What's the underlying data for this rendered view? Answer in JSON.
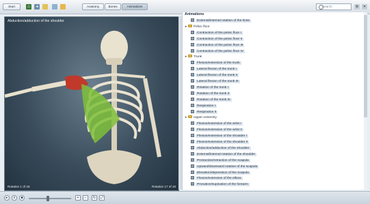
{
  "toolbar": {
    "start_label": "Start",
    "tabs": [
      "Anatomy",
      "Bones",
      "Animations"
    ],
    "active_tab": 2,
    "search_label": "Search",
    "icons": [
      "home-icon",
      "back-icon",
      "folder-icon",
      "open-icon",
      "lock-icon"
    ]
  },
  "viewer": {
    "title": "Abduction/adduction of the shoulder",
    "footer_left": "Rotation 1 of 18",
    "footer_right": "Rotation 17 of 18"
  },
  "panel": {
    "title": "Animations",
    "rows": [
      {
        "kind": "child",
        "label": "External/internal rotation of the knee"
      },
      {
        "kind": "folder",
        "label": "Pelvic floor"
      },
      {
        "kind": "child",
        "label": "Contraction of the pelvic floor I"
      },
      {
        "kind": "child",
        "label": "Contraction of the pelvic floor II"
      },
      {
        "kind": "child",
        "label": "Contraction of the pelvic floor III"
      },
      {
        "kind": "child",
        "label": "Contraction of the pelvic floor IV"
      },
      {
        "kind": "folder",
        "label": "Trunk"
      },
      {
        "kind": "child",
        "label": "Flexion/extension of the trunk"
      },
      {
        "kind": "child",
        "label": "Lateral flexion of the trunk I"
      },
      {
        "kind": "child",
        "label": "Lateral flexion of the trunk II"
      },
      {
        "kind": "child",
        "label": "Lateral flexion of the trunk III"
      },
      {
        "kind": "child",
        "label": "Rotation of the trunk I"
      },
      {
        "kind": "child",
        "label": "Rotation of the trunk II"
      },
      {
        "kind": "child",
        "label": "Rotation of the trunk III"
      },
      {
        "kind": "child",
        "label": "Respiration I"
      },
      {
        "kind": "child",
        "label": "Respiration II"
      },
      {
        "kind": "folder",
        "label": "Upper extremity"
      },
      {
        "kind": "child",
        "label": "Flexion/extension of the wrist I"
      },
      {
        "kind": "child",
        "label": "Flexion/extension of the wrist II"
      },
      {
        "kind": "child",
        "label": "Flexion/extension of the shoulder I"
      },
      {
        "kind": "child",
        "label": "Flexion/extension of the shoulder II"
      },
      {
        "kind": "child",
        "label": "Abduction/adduction of the shoulder"
      },
      {
        "kind": "child",
        "label": "External/internal rotation of the shoulder"
      },
      {
        "kind": "child",
        "label": "Protraction/retraction of the scapula"
      },
      {
        "kind": "child",
        "label": "Upward/downward rotation of the scapula"
      },
      {
        "kind": "child",
        "label": "Elevation/depression of the scapula"
      },
      {
        "kind": "child",
        "label": "Flexion/extension of the elbow"
      },
      {
        "kind": "child",
        "label": "Pronation/supination of the forearm"
      }
    ]
  },
  "bottombar": {
    "slider_value": 0.45
  },
  "colors": {
    "accent": "#3b6ea5",
    "muscle_green": "#7fbf3a",
    "muscle_red": "#c0392b"
  }
}
